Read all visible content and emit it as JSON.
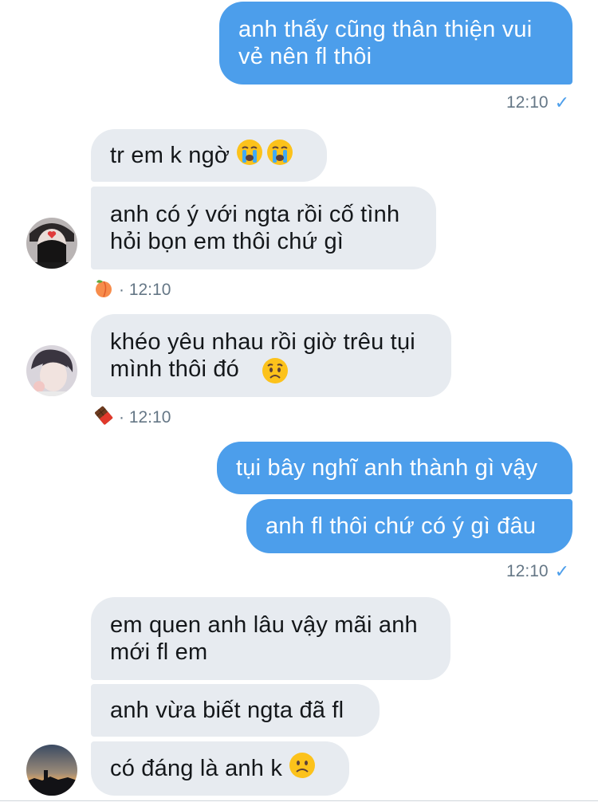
{
  "messages": {
    "m1": {
      "text": "anh thấy cũng thân thiện vui\nvẻ nên fl thôi"
    },
    "m2": {
      "text": "tr em k ngờ"
    },
    "m3": {
      "text": "anh có ý với ngta rồi cố tình\nhỏi bọn em thôi chứ gì"
    },
    "m4": {
      "text": "khéo yêu nhau rồi giờ trêu tụi\nmình thôi đó"
    },
    "m5": {
      "text": "tụi bây nghĩ anh thành gì vậy"
    },
    "m6": {
      "text": "anh fl thôi chứ có ý gì đâu"
    },
    "m7": {
      "text": "em quen anh lâu vậy mãi anh\nmới fl em"
    },
    "m8": {
      "text": "anh vừa biết ngta đã fl"
    },
    "m9": {
      "text": "có đáng là anh k"
    }
  },
  "timestamps": {
    "t1": "12:10",
    "t2": "· 12:10",
    "t3": "· 12:10",
    "t4": "12:10"
  },
  "status": {
    "read_check": "✓"
  },
  "reactions": {
    "r1": "peach-emoji",
    "r2": "chocolate-emoji"
  },
  "colors": {
    "outgoing_bubble": "#4c9eeb",
    "incoming_bubble": "#e7ebf0",
    "meta_text": "#657786"
  }
}
